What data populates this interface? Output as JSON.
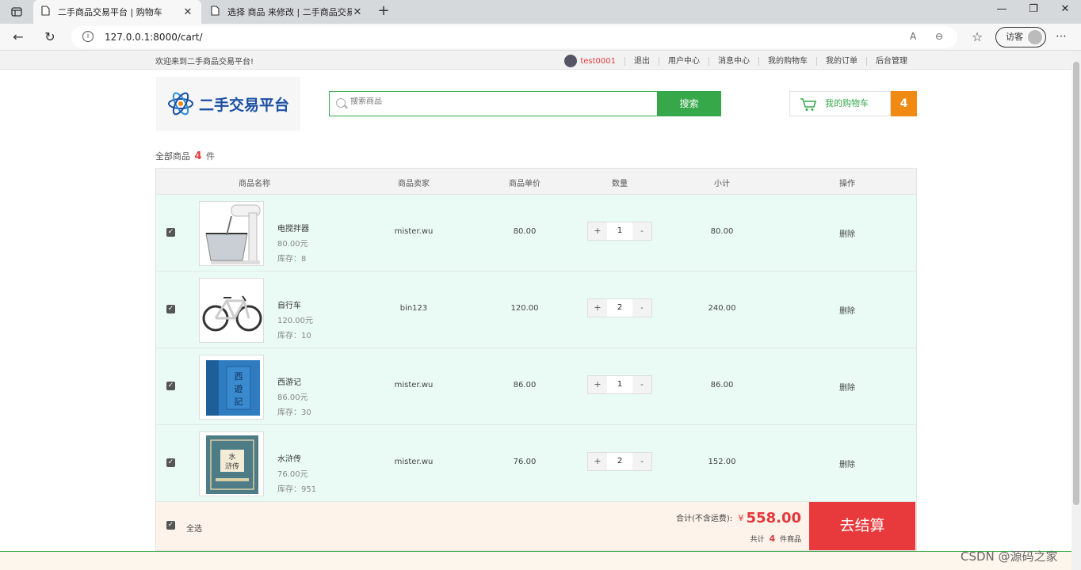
{
  "browser": {
    "tabs": [
      {
        "title": "二手商品交易平台 | 购物车",
        "active": true
      },
      {
        "title": "选择 商品 来修改 | 二手商品交易平台",
        "active": false
      }
    ],
    "url": "127.0.0.1:8000/cart/",
    "profile_label": "访客",
    "window_controls": [
      "minimize",
      "maximize",
      "close"
    ]
  },
  "topbar": {
    "welcome": "欢迎来到二手商品交易平台!",
    "username": "test0001",
    "links": [
      "退出",
      "用户中心",
      "消息中心",
      "我的购物车",
      "我的订单",
      "后台管理"
    ]
  },
  "header": {
    "logo_text": "二手交易平台",
    "search_placeholder": "搜索商品",
    "search_button": "搜索",
    "cart_label": "我的购物车",
    "cart_count": "4"
  },
  "cart": {
    "summary_prefix": "全部商品",
    "summary_count": "4",
    "summary_suffix": "件",
    "columns": [
      "商品名称",
      "商品卖家",
      "商品单价",
      "数量",
      "小计",
      "操作"
    ],
    "items": [
      {
        "name": "电搅拌器",
        "price_label": "80.00元",
        "stock": "库存：8",
        "seller": "mister.wu",
        "unit_price": "80.00",
        "qty": "1",
        "subtotal": "80.00",
        "action": "删除"
      },
      {
        "name": "自行车",
        "price_label": "120.00元",
        "stock": "库存：10",
        "seller": "bin123",
        "unit_price": "120.00",
        "qty": "2",
        "subtotal": "240.00",
        "action": "删除"
      },
      {
        "name": "西游记",
        "price_label": "86.00元",
        "stock": "库存：30",
        "seller": "mister.wu",
        "unit_price": "86.00",
        "qty": "1",
        "subtotal": "86.00",
        "action": "删除"
      },
      {
        "name": "水浒传",
        "price_label": "76.00元",
        "stock": "库存：951",
        "seller": "mister.wu",
        "unit_price": "76.00",
        "qty": "2",
        "subtotal": "152.00",
        "action": "删除"
      }
    ],
    "select_all": "全选",
    "total_label": "合计(不含运费):",
    "currency": "¥",
    "total_amount": "558.00",
    "count_prefix": "共计",
    "count_value": "4",
    "count_suffix": "件商品",
    "checkout_button": "去结算"
  },
  "watermark": "CSDN @源码之家",
  "colors": {
    "accent_green": "#36a84a",
    "price_red": "#e4393c",
    "cart_orange": "#f08a12",
    "row_bg": "#eafbf5"
  }
}
